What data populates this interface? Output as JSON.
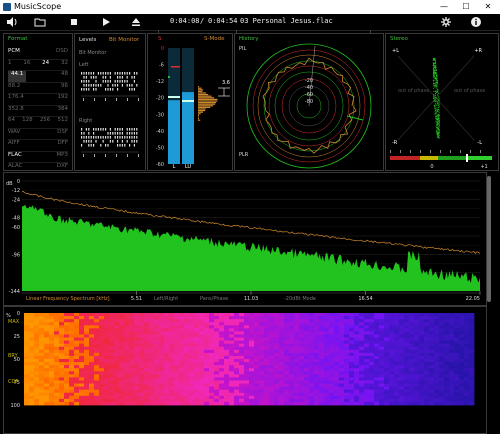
{
  "window": {
    "title": "MusicScope",
    "min": "—",
    "max": "☐",
    "close": "✕"
  },
  "toolbar": {
    "time_current": "0:04:08",
    "time_sep": "/",
    "time_total": "0:04:54",
    "track": "03 Personal Jesus.flac"
  },
  "format": {
    "title": "Format",
    "rows": [
      [
        "PCM",
        "DSD"
      ],
      [
        "1",
        "16",
        "24",
        "32"
      ],
      [
        "44.1",
        "48"
      ],
      [
        "88.2",
        "96"
      ],
      [
        "176.4",
        "192"
      ],
      [
        "352.8",
        "384"
      ],
      [
        "64",
        "128",
        "256",
        "512"
      ],
      [
        "WAV",
        "DSF"
      ],
      [
        "AIFF",
        "DFF"
      ],
      [
        "FLAC",
        "MP3"
      ],
      [
        "ALAC",
        "DXF"
      ]
    ]
  },
  "levels": {
    "title": "Levels",
    "mode": "Bit Monitor",
    "sub": "Bit Monitor",
    "left": "Left",
    "right": "Right"
  },
  "meter": {
    "peak_label": "S",
    "mode": "S-Mode",
    "scale": [
      "0",
      "-6",
      "-12",
      "-20",
      "-30",
      "-40",
      "-50",
      "-60"
    ],
    "ch_l": "L",
    "ch_r": "LU",
    "peak_value": "3.6",
    "bars": {
      "l_level": 0.55,
      "r_level": 0.62
    }
  },
  "history": {
    "title": "History",
    "pil": "PIL",
    "plr": "PLR",
    "rings": [
      "-20",
      "-40",
      "-60",
      "-80"
    ]
  },
  "stereo": {
    "title": "Stereo",
    "pl": "+L",
    "pr": "+R",
    "ml": "-R",
    "mr": "-L",
    "out1": "out of phase",
    "out2": "out of phase",
    "corr_zero": "0",
    "corr_plus": "+1"
  },
  "spectrum": {
    "db_label": "dB",
    "y_ticks": [
      "0",
      "-12",
      "-24",
      "-36",
      "-48",
      "-60",
      "-72",
      "-84",
      "-96",
      "-108",
      "-120",
      "-132",
      "-144"
    ],
    "title": "Linear Frequency Spectrum [kHz]",
    "x_ticks": [
      "5.51",
      "11.03",
      "16.54",
      "22.05"
    ],
    "mode1": "Left/Right",
    "mode2": "Pans/Phase",
    "mode3": "-20dBt Mode"
  },
  "spectrogram": {
    "pct": "%",
    "y_ticks": [
      "0",
      "25",
      "50",
      "75",
      "100"
    ],
    "overlay": [
      "MAX",
      "BRY",
      "COF"
    ]
  },
  "colors": {
    "green": "#22c21f",
    "orange": "#d08a2e",
    "cyan": "#1e9ad6",
    "red": "#d83030"
  }
}
